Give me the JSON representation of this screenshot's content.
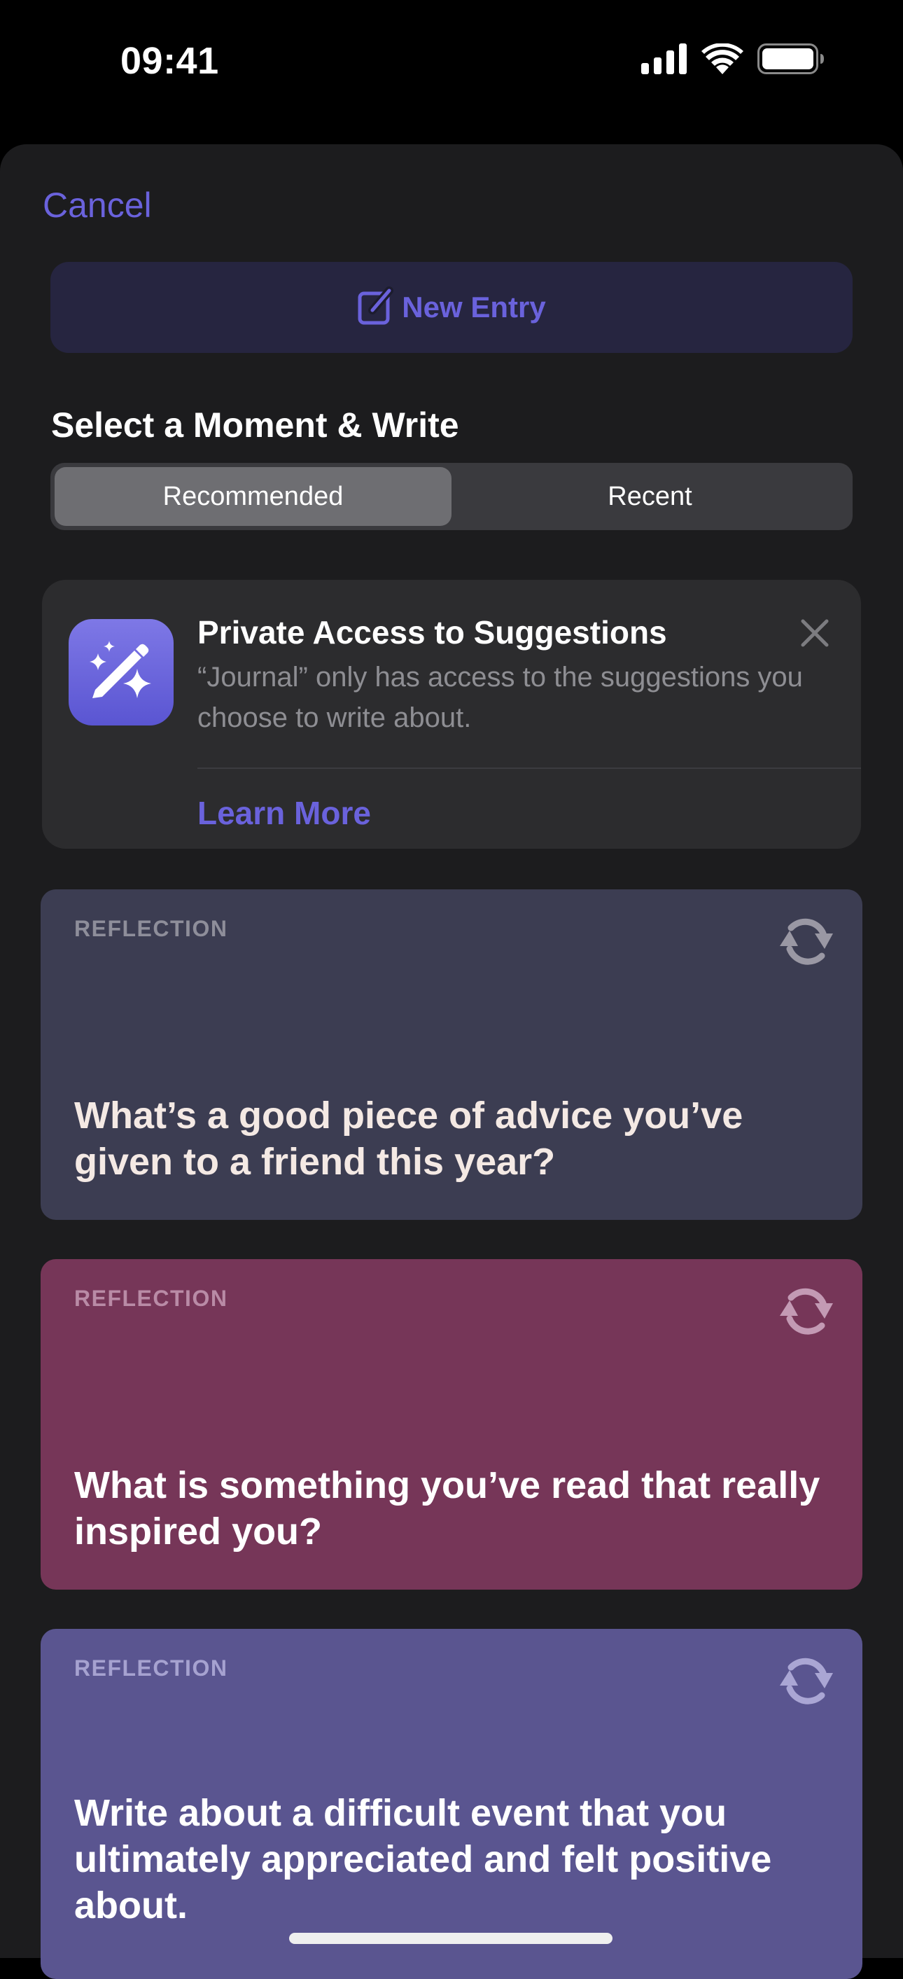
{
  "status_bar": {
    "time": "09:41",
    "icons": [
      "cellular-signal-icon",
      "wifi-icon",
      "battery-icon"
    ]
  },
  "header": {
    "cancel_label": "Cancel",
    "new_entry_label": "New Entry",
    "new_entry_icon": "compose-icon"
  },
  "section": {
    "title": "Select a Moment & Write"
  },
  "segmented_control": {
    "options": [
      "Recommended",
      "Recent"
    ],
    "selected": "Recommended"
  },
  "info_card": {
    "icon": "magic-wand-sparkles-icon",
    "title": "Private Access to Suggestions",
    "description": "“Journal” only has access to the suggestions you choose to write about.",
    "link_label": "Learn More",
    "close_icon": "close-icon"
  },
  "prompts": [
    {
      "category": "REFLECTION",
      "text": "What’s a good piece of advice you’ve given to a friend this year?",
      "bg_color": "#3c3d52",
      "label_color": "#8e8e9a",
      "text_color": "#f4e9e4",
      "icon_color": "#9a98a4"
    },
    {
      "category": "REFLECTION",
      "text": "What is something you’ve read that really inspired you?",
      "bg_color": "#763658",
      "label_color": "#b98ba6",
      "text_color": "#ffffff",
      "icon_color": "#c39ab4"
    },
    {
      "category": "REFLECTION",
      "text": "Write about a difficult event that you ultimately appreciated and felt positive about.",
      "bg_color": "#5a5590",
      "label_color": "#a6a2d0",
      "text_color": "#ffffff",
      "icon_color": "#aaa6d4"
    }
  ],
  "colors": {
    "accent": "#6a62dc",
    "sheet_background": "#1c1c1e",
    "card_background": "#2c2c2e"
  }
}
